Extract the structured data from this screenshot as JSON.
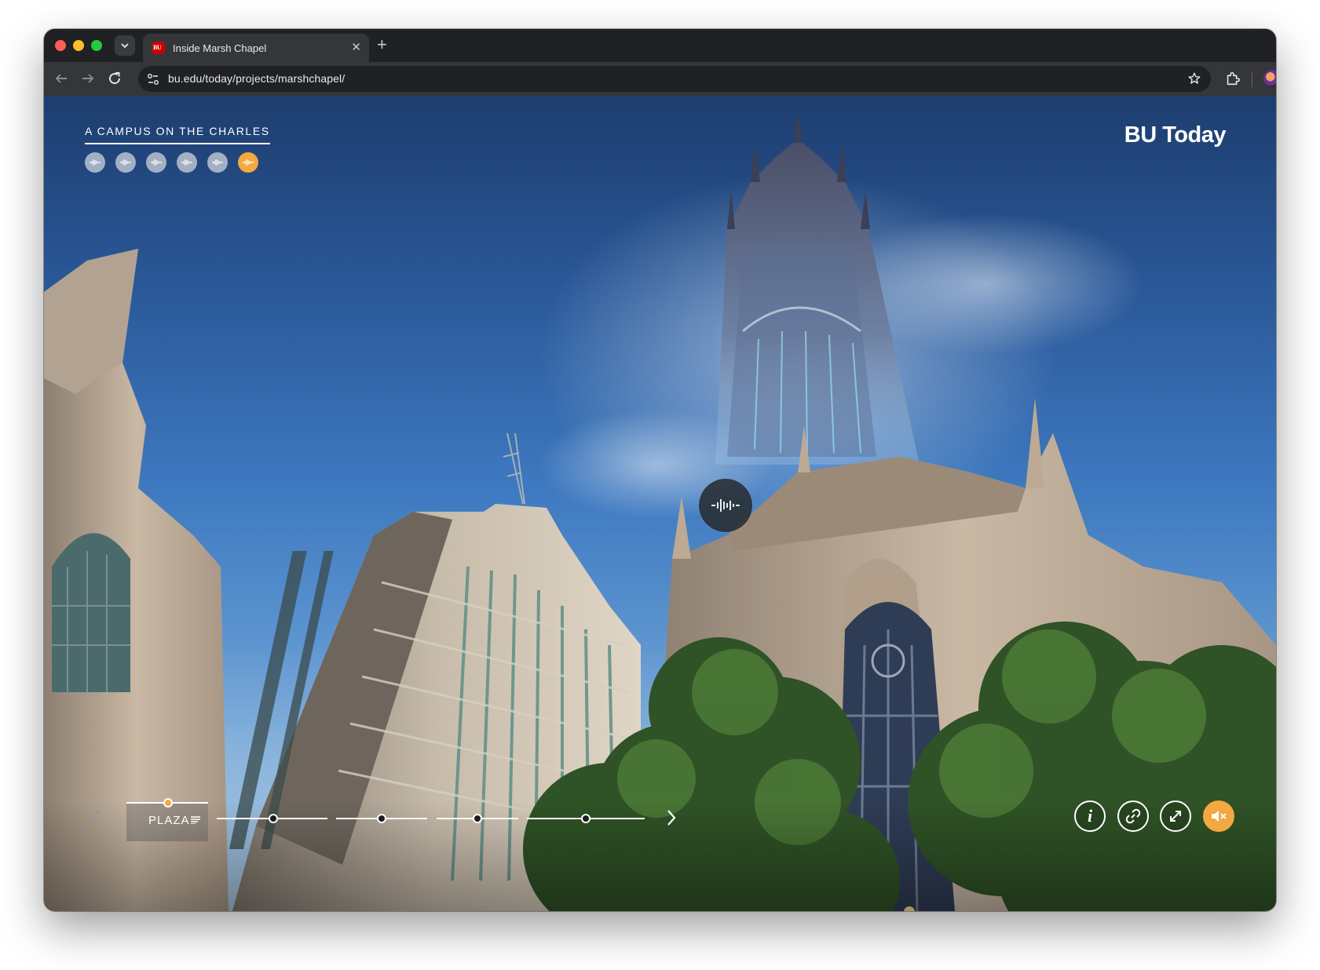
{
  "browser": {
    "tab_title": "Inside Marsh Chapel",
    "favicon_text": "BU",
    "url_host": "bu.edu",
    "url_path": "/today/projects/marshchapel/",
    "icons": [
      "tab-search-icon",
      "close-icon",
      "plus-icon",
      "back-icon",
      "forward-icon",
      "reload-icon",
      "site-info-icon",
      "star-icon",
      "extensions-icon",
      "profile-avatar",
      "more-menu-icon"
    ]
  },
  "page": {
    "eyebrow": "A CAMPUS ON THE CHARLES",
    "brand": "BU Today",
    "audio_points": [
      {
        "state": "default"
      },
      {
        "state": "default"
      },
      {
        "state": "default"
      },
      {
        "state": "default"
      },
      {
        "state": "default"
      },
      {
        "state": "active"
      }
    ],
    "hotspot_icon": "audio-wave-icon",
    "chapter_label": "PLAZA",
    "controls": [
      "info-icon",
      "link-icon",
      "fullscreen-icon",
      "mute-icon"
    ],
    "colors": {
      "accent": "#f3a842",
      "sky_top": "#1d3d6e",
      "sky_bottom": "#a7c4de"
    }
  }
}
